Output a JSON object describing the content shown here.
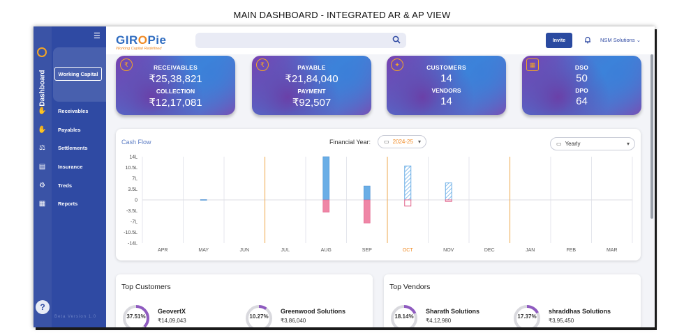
{
  "page_heading": "MAIN DASHBOARD - INTEGRATED AR & AP VIEW",
  "brand": {
    "name_pre": "GIR",
    "name_o": "O",
    "name_post": "Pie",
    "tagline": "Working Capital Redefined"
  },
  "topbar": {
    "invite_label": "Invite",
    "user_label": "NSM Solutions"
  },
  "sidebar": {
    "dashboard_label": "Dashboard",
    "working_capital_label": "Working Capital",
    "items": [
      {
        "label": "Receivables",
        "icon": "hand-coin-icon"
      },
      {
        "label": "Payables",
        "icon": "hand-pay-icon"
      },
      {
        "label": "Settlements",
        "icon": "settlement-icon"
      },
      {
        "label": "Insurance",
        "icon": "insurance-icon"
      },
      {
        "label": "Treds",
        "icon": "treds-icon"
      },
      {
        "label": "Reports",
        "icon": "reports-icon"
      }
    ],
    "help_label": "?",
    "version": "Beta Version 1.0"
  },
  "cards": [
    {
      "k1": "RECEIVABLES",
      "v1": "₹25,38,821",
      "k2": "COLLECTION",
      "v2": "₹12,17,081"
    },
    {
      "k1": "PAYABLE",
      "v1": "₹21,84,040",
      "k2": "PAYMENT",
      "v2": "₹92,507"
    },
    {
      "k1": "CUSTOMERS",
      "v1": "14",
      "k2": "VENDORS",
      "v2": "14"
    },
    {
      "k1": "DSO",
      "v1": "50",
      "k2": "DPO",
      "v2": "64"
    }
  ],
  "cashflow": {
    "title": "Cash Flow",
    "fy_label": "Financial Year:",
    "fy_value": "2024-25",
    "period_value": "Yearly",
    "highlight_month": "OCT"
  },
  "chart_data": {
    "type": "bar",
    "categories": [
      "APR",
      "MAY",
      "JUN",
      "JUL",
      "AUG",
      "SEP",
      "OCT",
      "NOV",
      "DEC",
      "JAN",
      "FEB",
      "MAR"
    ],
    "y_tick_labels": [
      "14L",
      "10.5L",
      "7L",
      "3.5L",
      "0",
      "-3.5L",
      "-7L",
      "-10.5L",
      "-14L"
    ],
    "ylim": [
      -14,
      14
    ],
    "series": [
      {
        "values": [
          0,
          0.1,
          0,
          0,
          14,
          4.5,
          11,
          5.5,
          0,
          0,
          0,
          0
        ]
      },
      {
        "values": [
          0,
          0,
          0,
          0,
          -4,
          -7.5,
          -2,
          -0.5,
          0,
          0,
          0,
          0
        ]
      }
    ],
    "hatched_months": [
      "OCT",
      "NOV"
    ],
    "marker_lines_after": [
      "JUN",
      "SEP",
      "DEC"
    ]
  },
  "top_customers": {
    "title": "Top Customers",
    "items": [
      {
        "name": "GeovertX",
        "amount": "₹14,09,043",
        "pct": "37.51%",
        "fraction": 0.3751
      },
      {
        "name": "Greenwood Solutions",
        "amount": "₹3,86,040",
        "pct": "10.27%",
        "fraction": 0.1027
      }
    ]
  },
  "top_vendors": {
    "title": "Top Vendors",
    "items": [
      {
        "name": "Sharath Solutions",
        "amount": "₹4,12,980",
        "pct": "18.14%",
        "fraction": 0.1814
      },
      {
        "name": "shraddhas Solutions",
        "amount": "₹3,95,450",
        "pct": "17.37%",
        "fraction": 0.1737
      }
    ]
  },
  "colors": {
    "accent": "#2f4aa3",
    "orange": "#f08a24",
    "inflow": "#6aaee6",
    "outflow": "#ef86a6",
    "ring": "#8f5bc0"
  }
}
